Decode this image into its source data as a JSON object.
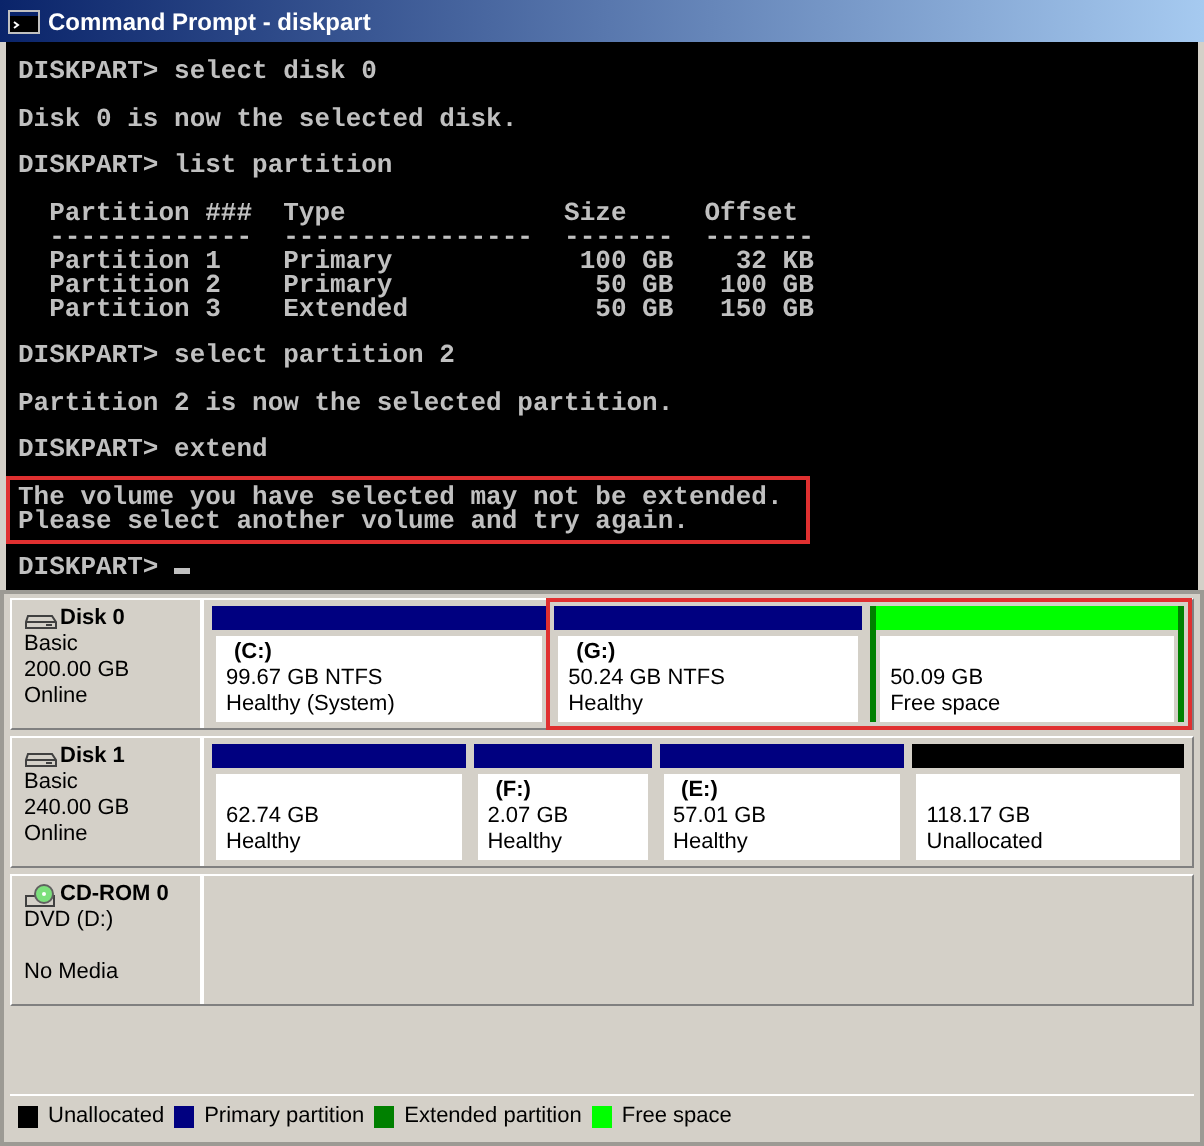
{
  "window": {
    "title": "Command Prompt - diskpart"
  },
  "console": {
    "blocks": [
      {
        "highlighted": false,
        "lines": [
          "DISKPART> select disk 0"
        ]
      },
      {
        "highlighted": false,
        "lines": [
          "Disk 0 is now the selected disk."
        ]
      },
      {
        "highlighted": false,
        "lines": [
          "DISKPART> list partition"
        ]
      },
      {
        "highlighted": false,
        "lines": [
          "  Partition ###  Type              Size     Offset",
          "  -------------  ----------------  -------  -------",
          "  Partition 1    Primary            100 GB    32 KB",
          "  Partition 2    Primary             50 GB   100 GB",
          "  Partition 3    Extended            50 GB   150 GB"
        ]
      },
      {
        "highlighted": false,
        "lines": [
          "DISKPART> select partition 2"
        ]
      },
      {
        "highlighted": false,
        "lines": [
          "Partition 2 is now the selected partition."
        ]
      },
      {
        "highlighted": false,
        "lines": [
          "DISKPART> extend"
        ]
      },
      {
        "highlighted": true,
        "lines": [
          "The volume you have selected may not be extended.",
          "Please select another volume and try again."
        ]
      },
      {
        "highlighted": false,
        "lines": [
          "DISKPART> "
        ],
        "cursor": true
      }
    ]
  },
  "disks": [
    {
      "kind": "disk",
      "name": "Disk 0",
      "details": [
        "Basic",
        "200.00 GB",
        "Online"
      ],
      "partitions": [
        {
          "kind": "primary",
          "label": "(C:)",
          "size": "99.67 GB NTFS",
          "status": "Healthy (System)",
          "highlighted": false
        },
        {
          "kind": "primary",
          "label": "(G:)",
          "size": "50.24 GB NTFS",
          "status": "Healthy",
          "highlighted": true
        },
        {
          "kind": "free",
          "size": "50.09 GB",
          "status": "Free space",
          "highlighted": true
        }
      ]
    },
    {
      "kind": "disk",
      "name": "Disk 1",
      "details": [
        "Basic",
        "240.00 GB",
        "Online"
      ],
      "partitions": [
        {
          "kind": "primary",
          "size": "62.74 GB",
          "status": "Healthy",
          "highlighted": false
        },
        {
          "kind": "primary",
          "label": "(F:)",
          "size": "2.07 GB",
          "status": "Healthy",
          "highlighted": false
        },
        {
          "kind": "primary",
          "label": "(E:)",
          "size": "57.01 GB",
          "status": "Healthy",
          "highlighted": false
        },
        {
          "kind": "unallocated",
          "size": "118.17 GB",
          "status": "Unallocated",
          "highlighted": false
        }
      ]
    },
    {
      "kind": "cdrom",
      "name": "CD-ROM 0",
      "details": [
        "DVD (D:)",
        "No Media"
      ]
    }
  ],
  "legend": [
    {
      "label": "Unallocated",
      "color": "#000000"
    },
    {
      "label": "Primary partition",
      "color": "#000080"
    },
    {
      "label": "Extended partition",
      "color": "#008000"
    },
    {
      "label": "Free space",
      "color": "#00ff00"
    }
  ]
}
